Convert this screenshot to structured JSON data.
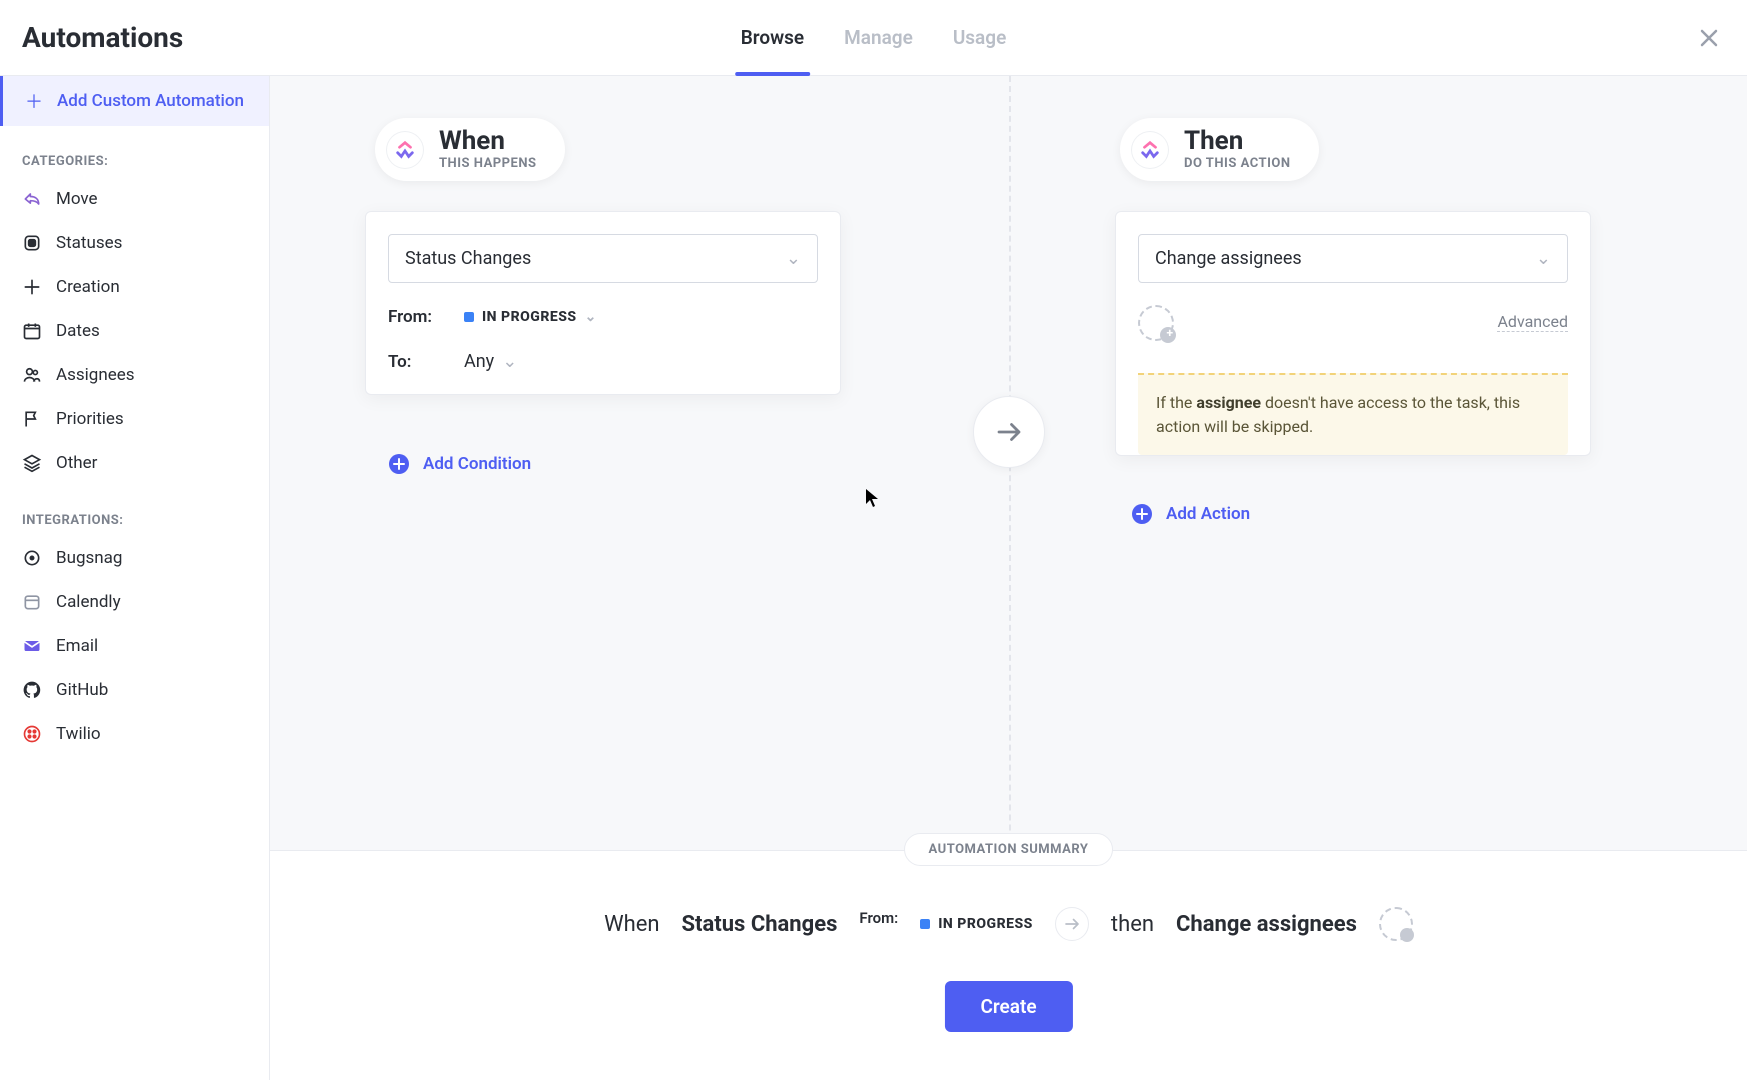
{
  "header": {
    "title": "Automations",
    "tabs": [
      {
        "label": "Browse",
        "active": true
      },
      {
        "label": "Manage",
        "active": false
      },
      {
        "label": "Usage",
        "active": false
      }
    ]
  },
  "sidebar": {
    "addCustom": "Add Custom Automation",
    "categoriesLabel": "Categories:",
    "categories": [
      {
        "label": "Move",
        "icon": "share"
      },
      {
        "label": "Statuses",
        "icon": "status"
      },
      {
        "label": "Creation",
        "icon": "plus-circle"
      },
      {
        "label": "Dates",
        "icon": "calendar"
      },
      {
        "label": "Assignees",
        "icon": "people"
      },
      {
        "label": "Priorities",
        "icon": "flag"
      },
      {
        "label": "Other",
        "icon": "layers"
      }
    ],
    "integrationsLabel": "Integrations:",
    "integrations": [
      {
        "label": "Bugsnag",
        "icon": "bugsnag"
      },
      {
        "label": "Calendly",
        "icon": "calendly"
      },
      {
        "label": "Email",
        "icon": "email"
      },
      {
        "label": "GitHub",
        "icon": "github"
      },
      {
        "label": "Twilio",
        "icon": "twilio"
      }
    ]
  },
  "when": {
    "title": "When",
    "subtitle": "This happens",
    "triggerSelected": "Status Changes",
    "fromLabel": "From:",
    "fromValue": "In Progress",
    "toLabel": "To:",
    "toValue": "Any",
    "addCondition": "Add Condition"
  },
  "then": {
    "title": "Then",
    "subtitle": "Do this action",
    "actionSelected": "Change assignees",
    "advanced": "Advanced",
    "warning": {
      "prefix": "If the ",
      "bold": "assignee",
      "suffix": " doesn't have access to the task, this action will be skipped."
    },
    "addAction": "Add Action"
  },
  "footer": {
    "summaryLabel": "Automation Summary",
    "whenWord": "When",
    "trigger": "Status Changes",
    "fromLabel": "From:",
    "fromValue": "In Progress",
    "thenWord": "then",
    "action": "Change assignees",
    "createButton": "Create"
  }
}
